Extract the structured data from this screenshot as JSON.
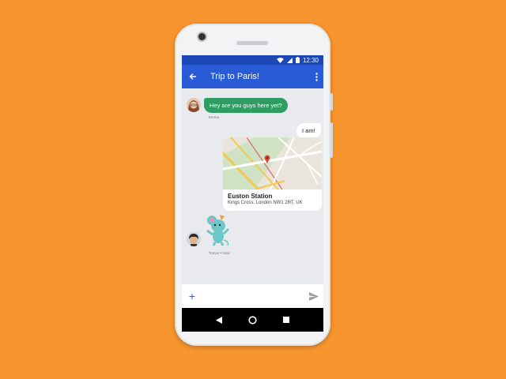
{
  "status_bar": {
    "time": "12:30"
  },
  "app_bar": {
    "title": "Trip to Paris!"
  },
  "messages": {
    "incoming_1": {
      "text": "Hey are you guys here yet?",
      "sender": "Emma"
    },
    "outgoing_1": {
      "text": "I am!"
    },
    "location_card": {
      "name": "Euston Station",
      "address": "Kings Cross, London NW1 2RT, UK"
    },
    "sticker_meta": "Tomas • Now"
  },
  "compose": {
    "placeholder": ""
  },
  "colors": {
    "background": "#f7952f",
    "app_bar": "#2a5bd7",
    "status_bar": "#1e47b6",
    "incoming_bubble": "#2e9d63"
  },
  "icons": [
    "back-arrow-icon",
    "more-vert-icon",
    "wifi-icon",
    "signal-icon",
    "battery-icon",
    "add-icon",
    "send-icon",
    "nav-back-icon",
    "nav-home-icon",
    "nav-recents-icon",
    "map-pin-icon"
  ]
}
